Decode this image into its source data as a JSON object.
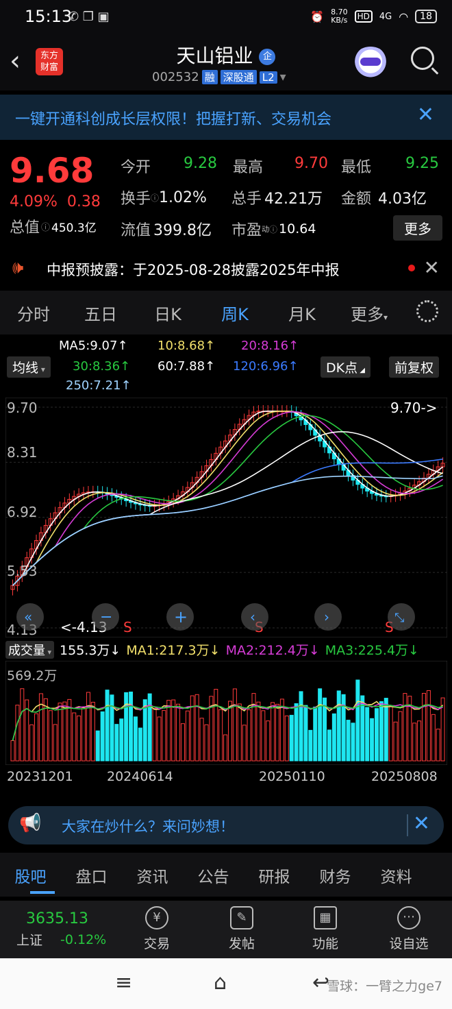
{
  "status_bar": {
    "time": "15:13",
    "net_speed": "8.70\nKB/s",
    "net_speed_value": "8.70",
    "net_speed_unit": "KB/s",
    "hd": "HD",
    "signal": "4G",
    "battery": "18"
  },
  "header": {
    "logo_line1": "东方",
    "logo_line2": "财富",
    "title": "天山铝业",
    "badge": "企",
    "code": "002532",
    "tags": [
      "融",
      "深股通",
      "L2"
    ]
  },
  "banner": {
    "text": "一键开通科创成长层权限！把握打新、交易机会"
  },
  "quote": {
    "price": "9.68",
    "pct": "4.09%",
    "chg": "0.38",
    "open_label": "今开",
    "open": "9.28",
    "high_label": "最高",
    "high": "9.70",
    "low_label": "最低",
    "low": "9.25",
    "turnover_label": "换手",
    "turnover": "1.02%",
    "volume_label": "总手",
    "volume": "42.21万",
    "amount_label": "金额",
    "amount": "4.03亿",
    "mktcap_label": "总值",
    "mktcap": "450.3亿",
    "float_label": "流值",
    "float": "399.8亿",
    "pe_label": "市盈",
    "pe_sup": "动",
    "pe": "10.64",
    "more": "更多"
  },
  "notice": {
    "text": "中报预披露：于2025-08-28披露2025年中报"
  },
  "tabs": [
    "分时",
    "五日",
    "日K",
    "周K",
    "月K",
    "更多"
  ],
  "active_tab": 3,
  "ma_legend": {
    "ma5": "MA5:9.07↑",
    "ma10": "10:8.68↑",
    "ma20": "20:8.16↑",
    "ma30": "30:8.36↑",
    "ma60": "60:7.88↑",
    "ma120": "120:6.96↑",
    "ma250": "250:7.21↑",
    "indicator": "均线",
    "dk": "DK点",
    "adjust": "前复权"
  },
  "colors": {
    "up": "#ff3b3b",
    "down": "#1ee6f0",
    "ma5": "#ffffff",
    "ma10": "#f2e06b",
    "ma20": "#d63cd6",
    "ma30": "#28c940",
    "ma60": "#ffffff",
    "ma120": "#3b7bff",
    "ma250": "#9fd3ff"
  },
  "chart_data": {
    "type": "candlestick",
    "price_axis": [
      "9.70",
      "8.31",
      "6.92",
      "5.53",
      "4.13"
    ],
    "ylim": [
      4.13,
      9.7
    ],
    "high_marker": "9.70->",
    "low_marker": "<-4.13",
    "signals": [
      "S",
      "S",
      "S"
    ],
    "dates": [
      "20231201",
      "20240614",
      "20250110",
      "20250808"
    ]
  },
  "volume": {
    "label": "成交量",
    "value": "155.3万↓",
    "ma1": "MA1:217.3万↓",
    "ma2": "MA2:212.4万↓",
    "ma3": "MA3:225.4万↓",
    "max": "569.2万"
  },
  "ask": {
    "text": "大家在炒什么？来问妙想！"
  },
  "bottom_tabs": [
    "股吧",
    "盘口",
    "资讯",
    "公告",
    "研报",
    "财务",
    "资料"
  ],
  "nav": {
    "index_value": "3635.13",
    "index_name": "上证",
    "index_chg": "-0.12%",
    "items": [
      "交易",
      "发帖",
      "功能",
      "设自选"
    ]
  },
  "watermark": "雪球：一臂之力ge7"
}
